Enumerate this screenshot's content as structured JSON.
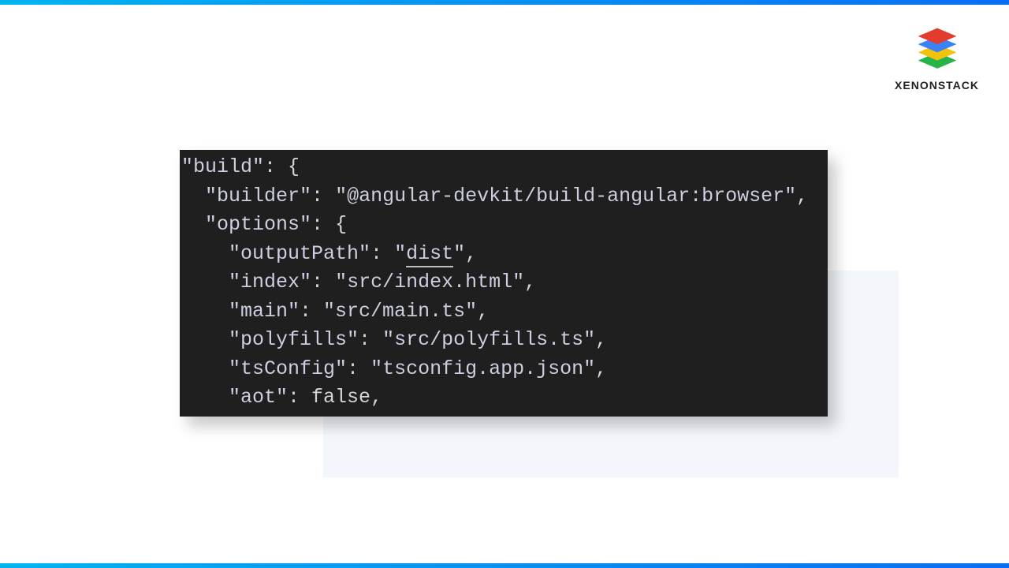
{
  "brand": {
    "name": "XENONSTACK"
  },
  "code": {
    "keys": {
      "build": "\"build\"",
      "builder": "\"builder\"",
      "options": "\"options\"",
      "outputPath": "\"outputPath\"",
      "index": "\"index\"",
      "main": "\"main\"",
      "polyfills": "\"polyfills\"",
      "tsConfig": "\"tsConfig\"",
      "aot": "\"aot\""
    },
    "values": {
      "builder": "\"@angular-devkit/build-angular:browser\"",
      "outputPath_open": "\"",
      "outputPath_text": "dist",
      "outputPath_close": "\"",
      "index": "\"src/index.html\"",
      "main": "\"src/main.ts\"",
      "polyfills": "\"src/polyfills.ts\"",
      "tsConfig": "\"tsconfig.app.json\"",
      "aot": "false"
    },
    "punct": {
      "colon_brace": ": {",
      "colon_sp": ": ",
      "brace": "{",
      "comma": ","
    }
  }
}
